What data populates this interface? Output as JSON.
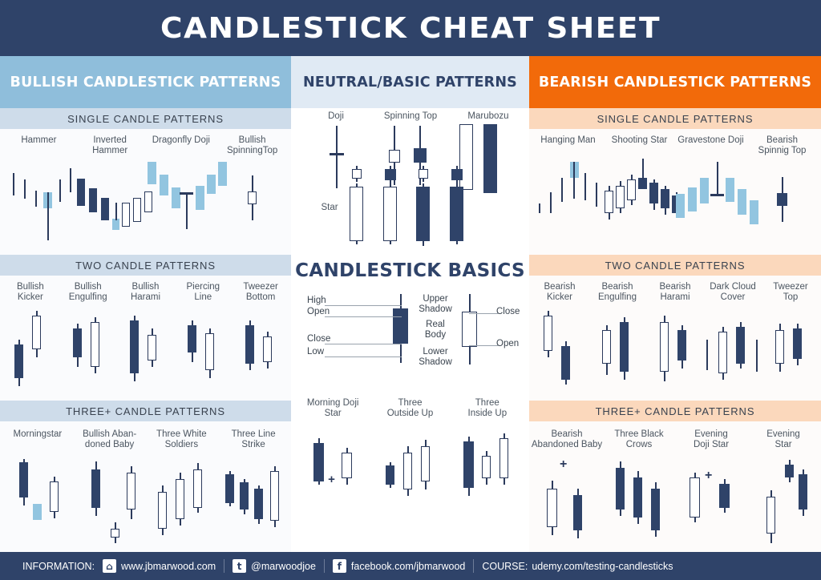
{
  "header": {
    "title": "CANDLESTICK CHEAT SHEET"
  },
  "columns": {
    "bullish": {
      "title": "BULLISH CANDLESTICK PATTERNS"
    },
    "neutral": {
      "title": "NEUTRAL/BASIC PATTERNS"
    },
    "bearish": {
      "title": "BEARISH CANDLESTICK PATTERNS"
    }
  },
  "bands": {
    "single": "SINGLE CANDLE PATTERNS",
    "two": "TWO CANDLE PATTERNS",
    "three": "THREE+ CANDLE PATTERNS"
  },
  "bullish_single": [
    {
      "label": "Hammer"
    },
    {
      "label": "Inverted\nHammer"
    },
    {
      "label": "Dragonfly Doji"
    },
    {
      "label": "Bullish\nSpinningTop"
    }
  ],
  "bullish_two": [
    {
      "label": "Bullish\nKicker"
    },
    {
      "label": "Bullish\nEngulfing"
    },
    {
      "label": "Bullish\nHarami"
    },
    {
      "label": "Piercing\nLine"
    },
    {
      "label": "Tweezer\nBottom"
    }
  ],
  "bullish_three": [
    {
      "label": "Morningstar"
    },
    {
      "label": "Bullish Aban-\ndoned Baby"
    },
    {
      "label": "Three White\nSoldiers"
    },
    {
      "label": "Three Line\nStrike"
    }
  ],
  "neutral_single": [
    {
      "label": "Doji"
    },
    {
      "label": "Spinning Top"
    },
    {
      "label": "Marubozu"
    }
  ],
  "neutral_star_label": "Star",
  "neutral_three": [
    {
      "label": "Morning Doji\nStar"
    },
    {
      "label": "Three\nOutside Up"
    },
    {
      "label": "Three\nInside Up"
    }
  ],
  "bearish_single": [
    {
      "label": "Hanging Man"
    },
    {
      "label": "Shooting Star"
    },
    {
      "label": "Gravestone Doji"
    },
    {
      "label": "Bearish\nSpinnig Top"
    }
  ],
  "bearish_two": [
    {
      "label": "Bearish\nKicker"
    },
    {
      "label": "Bearish\nEngulfing"
    },
    {
      "label": "Bearish\nHarami"
    },
    {
      "label": "Dark Cloud\nCover"
    },
    {
      "label": "Tweezer\nTop"
    }
  ],
  "bearish_three": [
    {
      "label": "Bearish\nAbandoned Baby"
    },
    {
      "label": "Three Black\nCrows"
    },
    {
      "label": "Evening\nDoji Star"
    },
    {
      "label": "Evening\nStar"
    }
  ],
  "basics": {
    "title": "CANDLESTICK BASICS",
    "high": "High",
    "open": "Open",
    "close": "Close",
    "low": "Low",
    "upper_shadow": "Upper\nShadow",
    "real_body": "Real\nBody",
    "lower_shadow": "Lower\nShadow",
    "right_close": "Close",
    "right_open": "Open"
  },
  "footer": {
    "information_label": "INFORMATION:",
    "website": "www.jbmarwood.com",
    "website_icon": "home-icon",
    "twitter": "@marwoodjoe",
    "twitter_icon": "twitter-icon",
    "facebook": "facebook.com/jbmarwood",
    "facebook_icon": "facebook-icon",
    "course_label": "COURSE:",
    "course": "udemy.com/testing-candlesticks"
  },
  "colors": {
    "navy": "#2f4369",
    "orange": "#f26a0a",
    "light_blue_header": "#8fbedb",
    "pale_blue": "#e0eaf4",
    "band_blue": "#cedcea",
    "band_peach": "#fbd8bc",
    "candle_light": "#92c5e0"
  }
}
